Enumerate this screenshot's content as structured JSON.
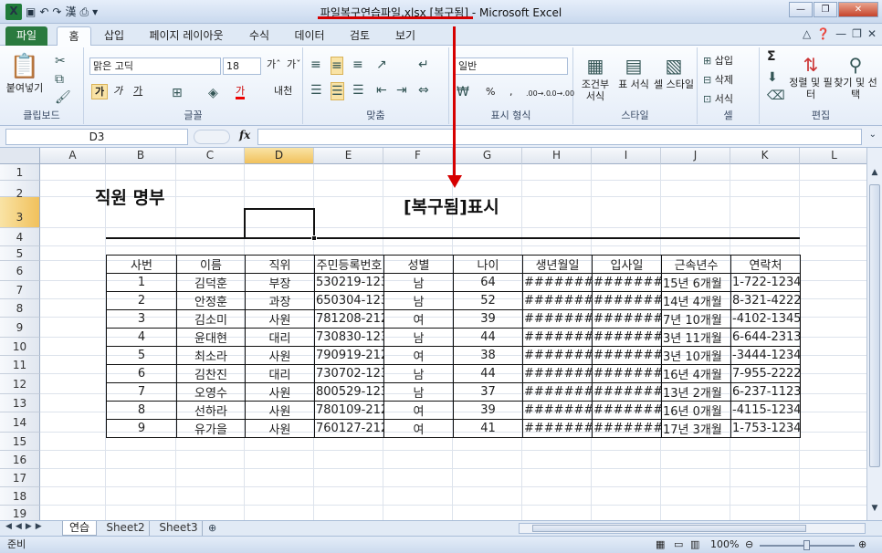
{
  "window": {
    "title_file": "파일복구연습파일.xlsx [복구됨]",
    "title_sep": " - ",
    "title_app": "Microsoft Excel"
  },
  "ribbon_tabs": [
    "파일",
    "홈",
    "삽입",
    "페이지 레이아웃",
    "수식",
    "데이터",
    "검토",
    "보기"
  ],
  "ribbon": {
    "clipboard": {
      "paste": "붙여넣기",
      "title": "클립보드"
    },
    "font": {
      "name": "맑은 고딕",
      "size": "18",
      "bold": "가",
      "italic": "가",
      "underline": "가",
      "color_a": "가",
      "phonetic": "내천",
      "title": "글꼴"
    },
    "align": {
      "title": "맞춤"
    },
    "number": {
      "format": "일반",
      "percent": "%",
      "comma": ",",
      "dec_inc": ".00→.0",
      "dec_dec": ".0→.00",
      "title": "표시 형식"
    },
    "styles": {
      "cond": "조건부 서식",
      "table": "표 서식",
      "cell": "셀 스타일",
      "title": "스타일"
    },
    "cells": {
      "insert": "삽입",
      "delete": "삭제",
      "format": "서식",
      "title": "셀"
    },
    "edit": {
      "sigma": "Σ",
      "sort": "정렬 및 필터",
      "find": "찾기 및 선택",
      "title": "편집"
    }
  },
  "formula_bar": {
    "name_box": "D3",
    "fx": "fx",
    "value": ""
  },
  "columns": [
    "A",
    "B",
    "C",
    "D",
    "E",
    "F",
    "G",
    "H",
    "I",
    "J",
    "K",
    "L"
  ],
  "rows": [
    "1",
    "2",
    "3",
    "4",
    "5",
    "6",
    "7",
    "8",
    "9",
    "10",
    "11",
    "12",
    "13",
    "14",
    "15",
    "16",
    "17",
    "18",
    "19"
  ],
  "sheet_title": "직원 명부",
  "annotation": "[복구됨]표시",
  "table": {
    "headers": [
      "사번",
      "이름",
      "직위",
      "주민등록번호",
      "성별",
      "나이",
      "생년월일",
      "입사일",
      "근속년수",
      "연락처"
    ],
    "rows": [
      [
        "1",
        "김덕훈",
        "부장",
        "530219-123",
        "남",
        "64",
        "########",
        "########",
        "15년 6개월",
        "1-722-1234"
      ],
      [
        "2",
        "안정훈",
        "과장",
        "650304-123",
        "남",
        "52",
        "########",
        "########",
        "14년 4개월",
        "8-321-4222"
      ],
      [
        "3",
        "김소미",
        "사원",
        "781208-212",
        "여",
        "39",
        "########",
        "########",
        "7년 10개월",
        "-4102-1345"
      ],
      [
        "4",
        "윤대현",
        "대리",
        "730830-123",
        "남",
        "44",
        "########",
        "########",
        "3년 11개월",
        "6-644-2313"
      ],
      [
        "5",
        "최소라",
        "사원",
        "790919-212",
        "여",
        "38",
        "########",
        "########",
        "3년 10개월",
        "-3444-1234"
      ],
      [
        "6",
        "김찬진",
        "대리",
        "730702-123",
        "남",
        "44",
        "########",
        "########",
        "16년 4개월",
        "7-955-2222"
      ],
      [
        "7",
        "오영수",
        "사원",
        "800529-123",
        "남",
        "37",
        "########",
        "########",
        "13년 2개월",
        "6-237-1123"
      ],
      [
        "8",
        "선하라",
        "사원",
        "780109-212",
        "여",
        "39",
        "########",
        "########",
        "16년 0개월",
        "-4115-1234"
      ],
      [
        "9",
        "유가을",
        "사원",
        "760127-212",
        "여",
        "41",
        "########",
        "########",
        "17년 3개월",
        "1-753-1234"
      ]
    ]
  },
  "sheet_tabs": [
    "연습",
    "Sheet2",
    "Sheet3"
  ],
  "status": {
    "ready": "준비",
    "zoom": "100%"
  },
  "colors": {
    "accent": "#2a7a3f",
    "annotation": "#d60000",
    "selected_header": "#f1c15c"
  }
}
